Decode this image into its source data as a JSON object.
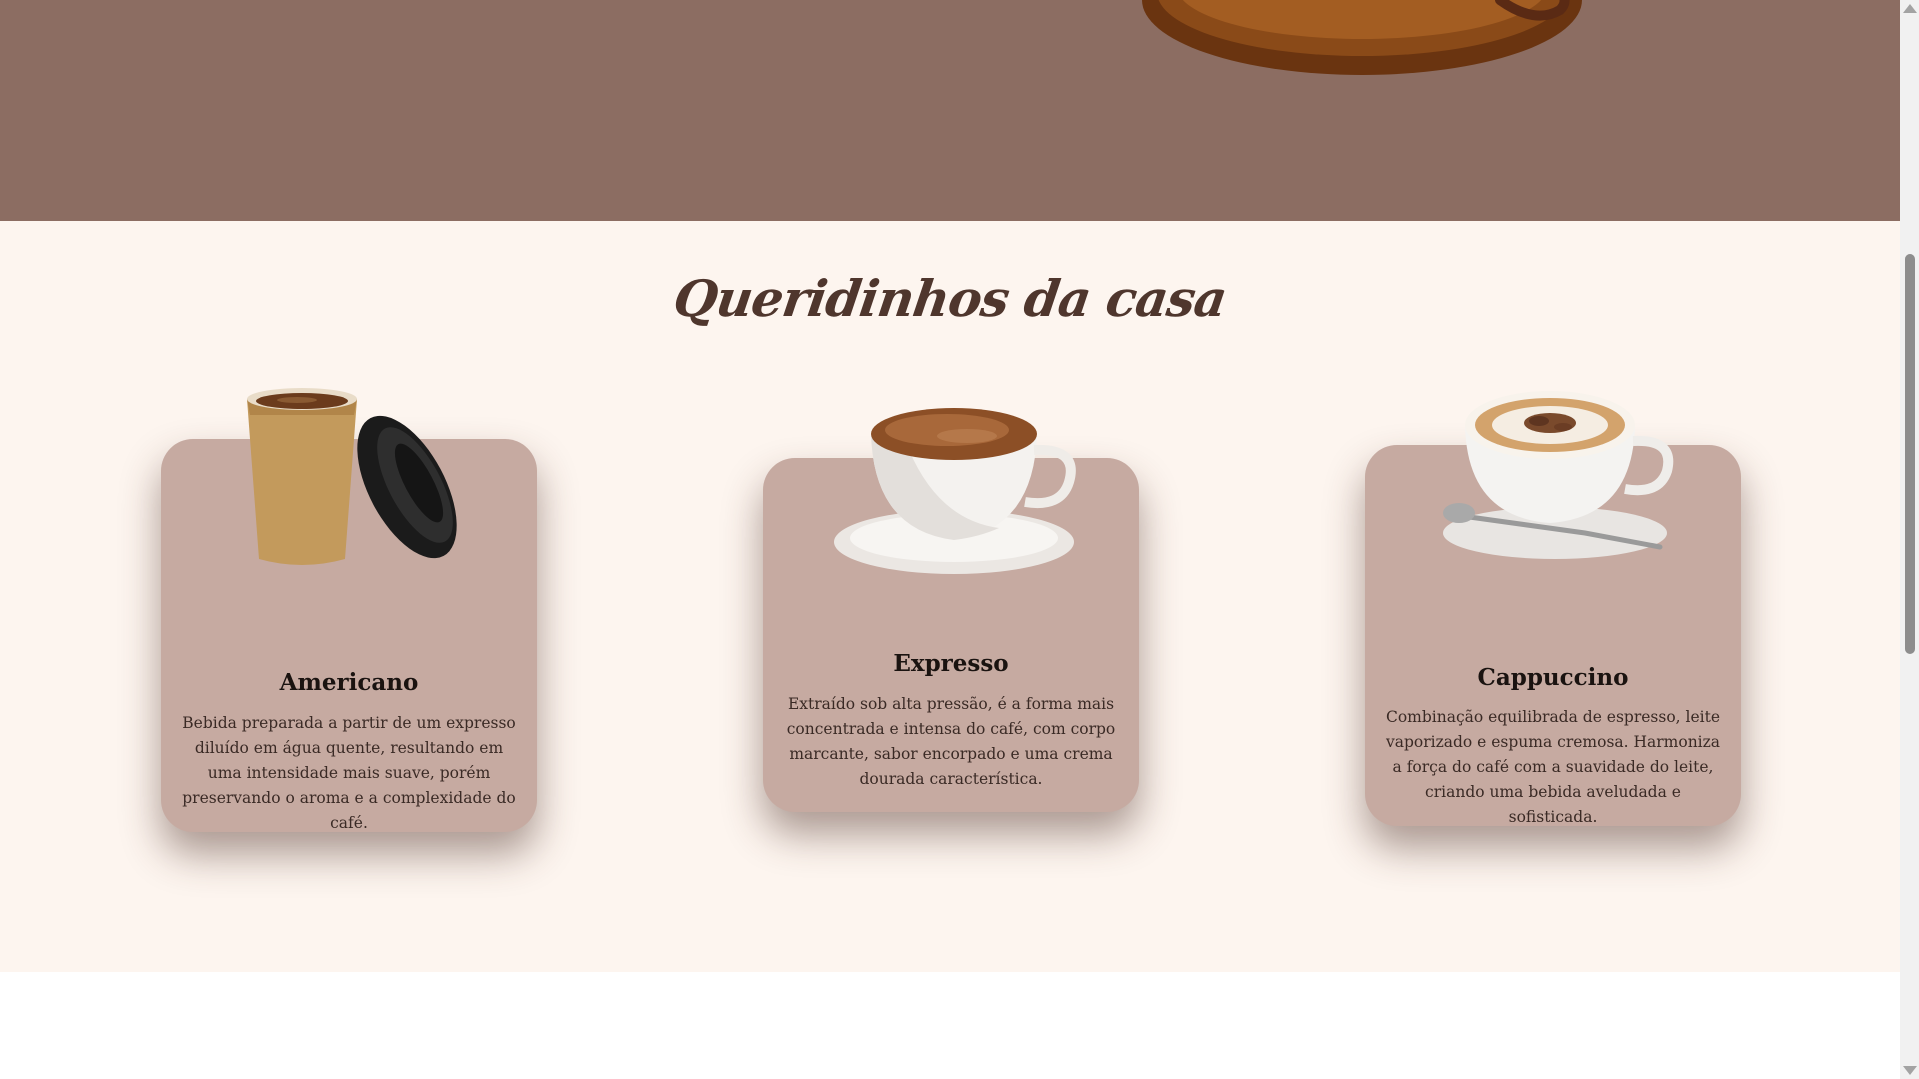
{
  "section": {
    "title": "Queridinhos da casa"
  },
  "cards": [
    {
      "title": "Americano",
      "description": "Bebida preparada a partir de um expresso diluído em água quente, resultando em uma intensidade mais suave, porém preservando o aroma e a complexidade do café."
    },
    {
      "title": "Expresso",
      "description": "Extraído sob alta pressão, é a forma mais concentrada e intensa do café, com corpo marcante, sabor encorpado e uma crema dourada característica."
    },
    {
      "title": "Cappuccino",
      "description": "Combinação equilibrada de espresso, leite vaporizado e espuma cremosa. Harmoniza a força do café com a suavidade do leite, criando uma bebida aveludada e sofisticada."
    }
  ],
  "colors": {
    "hero_background": "#8c6d62",
    "section_background": "#fdf5ef",
    "card_background": "#c6aaa1",
    "title_color": "#4f362d"
  },
  "icons": {
    "hero": "plate-with-sweets-image",
    "card_0": "takeaway-coffee-cup-image",
    "card_1": "espresso-cup-image",
    "card_2": "cappuccino-cup-image"
  }
}
